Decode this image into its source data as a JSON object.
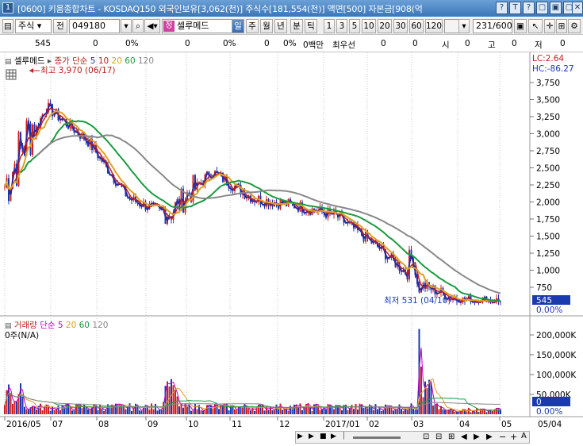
{
  "window": {
    "number": "1",
    "title": "[0600] 키움종합차트 - KOSDAQ150 외국인보유[3,062(천)] 주식수[181,554(천)] 액면[500] 자본금[908(억"
  },
  "titlebar_buttons": [
    "?",
    "T",
    "?",
    "▢",
    "▣",
    "▢",
    "✕"
  ],
  "toolbar": {
    "market": "주식",
    "prev_label": "전",
    "stock_code": "049180",
    "stock_name_badge": "정",
    "stock_name": "셀루메드",
    "periods": [
      "일",
      "주",
      "월",
      "년",
      "분",
      "틱"
    ],
    "active_period": "일",
    "minute_options": [
      "1",
      "3",
      "5",
      "10",
      "20",
      "30",
      "60",
      "120"
    ],
    "page_counter": "231/600"
  },
  "infobar": {
    "price": "545",
    "change": "0",
    "change_pct": "0%",
    "v3": "0",
    "v4": "0%",
    "v5": "0",
    "v6": "0%",
    "volume_amount": "0백만",
    "priority_label": "최우선",
    "ask": "0",
    "bid": "0",
    "open_label": "시",
    "open_value": "0",
    "high_label": "고",
    "high_value": "0",
    "low_label": "저",
    "low_value": "0"
  },
  "price_panel": {
    "legend_name": "셀루메드",
    "legend_type": "종가 단순",
    "ma_labels": [
      "5",
      "10",
      "20",
      "60",
      "120"
    ],
    "ma_colors": [
      "#2a2a9e",
      "#c02020",
      "#e0a020",
      "#1a9a40",
      "#888888"
    ],
    "max_annotation": "최고 3,970 (06/17)",
    "min_annotation": "최저 531 (04/10)",
    "lc_label": "LC:2.64",
    "hc_label": "HC:-86.27",
    "current_price_tag": "545",
    "current_pct_tag": "0.00%",
    "y_ticks": [
      "3,750",
      "3,500",
      "3,250",
      "3,000",
      "2,750",
      "2,500",
      "2,250",
      "2,000",
      "1,750",
      "1,500",
      "1,250",
      "1,000",
      "750"
    ]
  },
  "volume_panel": {
    "legend_name": "거래량",
    "legend_type": "단순",
    "ma_labels": [
      "5",
      "20",
      "60",
      "120"
    ],
    "ma_colors": [
      "#c000c0",
      "#e0a020",
      "#1a9a40",
      "#888888"
    ],
    "unit_label": "0주(N/A)",
    "y_ticks": [
      "200,000K",
      "150,000K",
      "100,000K",
      "50,000K"
    ],
    "current_tag": "0",
    "current_pct_tag": "0.00%"
  },
  "x_axis": {
    "labels": [
      "2016/05",
      "07",
      "08",
      "09",
      "10",
      "11",
      "12",
      "2017/01",
      "02",
      "03",
      "04",
      "05"
    ],
    "right_label": "05/04"
  },
  "chart_data": {
    "type": "line",
    "title": "셀루메드",
    "date_range": [
      "2016/05",
      "2017/05"
    ],
    "ylim": [
      500,
      3970
    ],
    "approx_close": [
      {
        "x": "2016/05",
        "y": 2050
      },
      {
        "x": "2016/06",
        "y": 3400
      },
      {
        "x": "2016/07",
        "y": 2900
      },
      {
        "x": "2016/08",
        "y": 2050
      },
      {
        "x": "2016/09",
        "y": 1800
      },
      {
        "x": "2016/10",
        "y": 2450
      },
      {
        "x": "2016/11",
        "y": 2050
      },
      {
        "x": "2016/12",
        "y": 1950
      },
      {
        "x": "2017/01",
        "y": 1800
      },
      {
        "x": "2017/02",
        "y": 1350
      },
      {
        "x": "2017/03",
        "y": 800
      },
      {
        "x": "2017/04",
        "y": 560
      },
      {
        "x": "2017/05",
        "y": 545
      }
    ],
    "series": [
      {
        "name": "20",
        "color": "#e0a020"
      },
      {
        "name": "60",
        "color": "#1a9a40"
      },
      {
        "name": "120",
        "color": "#888888"
      }
    ]
  }
}
